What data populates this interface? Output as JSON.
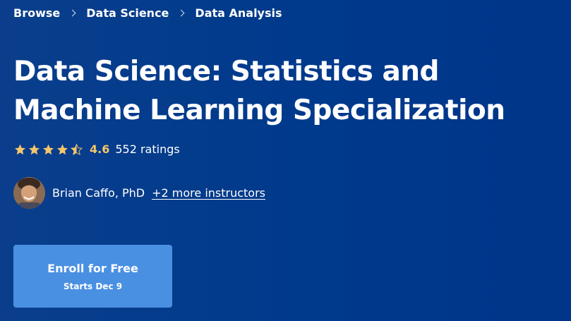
{
  "breadcrumb": {
    "items": [
      "Browse",
      "Data Science",
      "Data Analysis"
    ]
  },
  "course": {
    "title": "Data Science: Statistics and Machine Learning Specialization",
    "rating": "4.6",
    "rating_stars": 4.5,
    "ratings_count": "552 ratings"
  },
  "instructors": {
    "primary": "Brian Caffo, PhD",
    "more": "+2 more instructors"
  },
  "enroll": {
    "label": "Enroll for Free",
    "start": "Starts Dec 9"
  },
  "colors": {
    "background": "#003a8c",
    "button": "#4a90e2",
    "star": "#f5c76a"
  }
}
